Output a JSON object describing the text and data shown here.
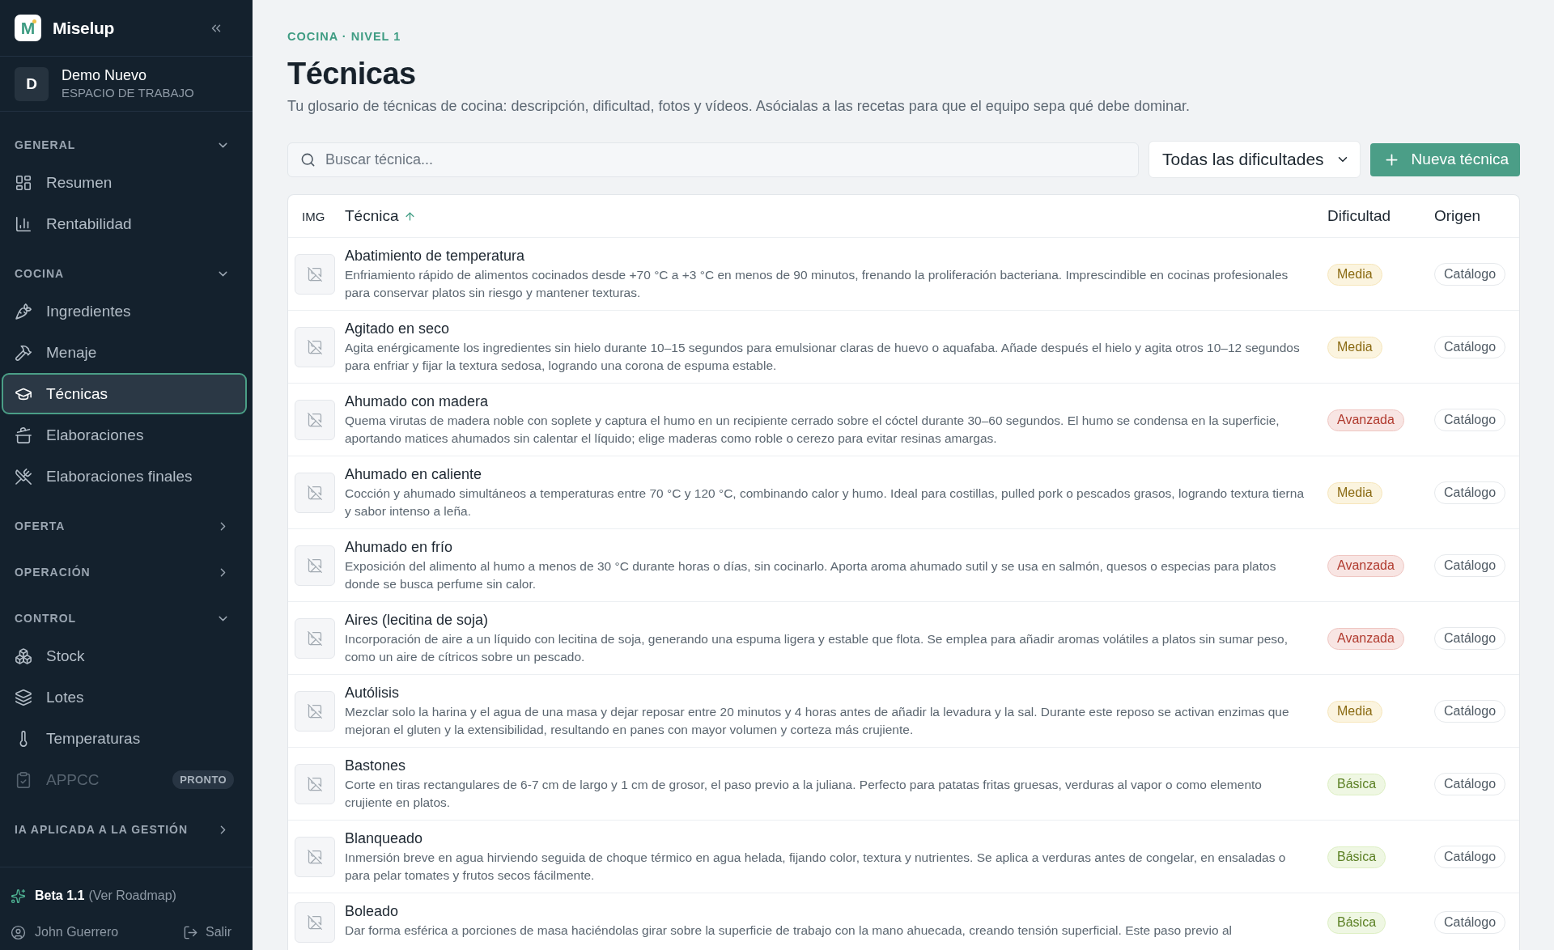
{
  "sidebar": {
    "brand": {
      "logo_letter": "M",
      "name": "Miselup"
    },
    "workspace": {
      "initial": "D",
      "name": "Demo Nuevo",
      "subtitle": "ESPACIO DE TRABAJO"
    },
    "sections": [
      {
        "label": "GENERAL",
        "expanded": true,
        "items": [
          {
            "label": "Resumen",
            "selected": false,
            "disabled": false
          },
          {
            "label": "Rentabilidad",
            "selected": false,
            "disabled": false
          }
        ]
      },
      {
        "label": "COCINA",
        "expanded": true,
        "items": [
          {
            "label": "Ingredientes",
            "selected": false,
            "disabled": false
          },
          {
            "label": "Menaje",
            "selected": false,
            "disabled": false
          },
          {
            "label": "Técnicas",
            "selected": true,
            "disabled": false
          },
          {
            "label": "Elaboraciones",
            "selected": false,
            "disabled": false
          },
          {
            "label": "Elaboraciones finales",
            "selected": false,
            "disabled": false
          }
        ]
      },
      {
        "label": "OFERTA",
        "expanded": false
      },
      {
        "label": "OPERACIÓN",
        "expanded": false
      },
      {
        "label": "CONTROL",
        "expanded": true,
        "items": [
          {
            "label": "Stock",
            "selected": false,
            "disabled": false
          },
          {
            "label": "Lotes",
            "selected": false,
            "disabled": false
          },
          {
            "label": "Temperaturas",
            "selected": false,
            "disabled": false
          },
          {
            "label": "APPCC",
            "selected": false,
            "disabled": true,
            "badge": "PRONTO"
          }
        ]
      },
      {
        "label": "IA APLICADA A LA GESTIÓN",
        "expanded": false
      }
    ],
    "footer": {
      "version": "Beta 1.1",
      "roadmap_link": "(Ver Roadmap)",
      "user": "John Guerrero",
      "logout": "Salir"
    }
  },
  "header": {
    "breadcrumb": "COCINA · NIVEL 1",
    "title": "Técnicas",
    "description": "Tu glosario de técnicas de cocina: descripción, dificultad, fotos y vídeos. Asócialas a las recetas para que el equipo sepa qué debe dominar."
  },
  "toolbar": {
    "search": {
      "placeholder": "Buscar técnica..."
    },
    "filter": {
      "value": "Todas las dificultades"
    },
    "new_button": "Nueva técnica"
  },
  "table": {
    "columns": [
      {
        "label": "IMG",
        "sorted": false
      },
      {
        "label": "Técnica",
        "sorted": true
      },
      {
        "label": "Dificultad",
        "sorted": false
      },
      {
        "label": "Origen",
        "sorted": false
      }
    ],
    "rows": [
      {
        "name": "Abatimiento de temperatura",
        "description": "Enfriamiento rápido de alimentos cocinados desde +70 °C a +3 °C en menos de 90 minutos, frenando la proliferación bacteriana. Imprescindible en cocinas profesionales para conservar platos sin riesgo y mantener texturas.",
        "difficulty": {
          "label": "Media",
          "color": "#8a6a12"
        },
        "origin": "Catálogo"
      },
      {
        "name": "Agitado en seco",
        "description": "Agita enérgicamente los ingredientes sin hielo durante 10–15 segundos para emulsionar claras de huevo o aquafaba. Añade después el hielo y agita otros 10–12 segundos para enfriar y fijar la textura sedosa, logrando una corona de espuma estable.",
        "difficulty": {
          "label": "Media",
          "color": "#8a6a12"
        },
        "origin": "Catálogo"
      },
      {
        "name": "Ahumado con madera",
        "description": "Quema virutas de madera noble con soplete y captura el humo en un recipiente cerrado sobre el cóctel durante 30–60 segundos. El humo se condensa en la superficie, aportando matices ahumados sin calentar el líquido; elige maderas como roble o cerezo para evitar resinas amargas.",
        "difficulty": {
          "label": "Avanzada",
          "color": "#b03a2e"
        },
        "origin": "Catálogo"
      },
      {
        "name": "Ahumado en caliente",
        "description": "Cocción y ahumado simultáneos a temperaturas entre 70 °C y 120 °C, combinando calor y humo. Ideal para costillas, pulled pork o pescados grasos, logrando textura tierna y sabor intenso a leña.",
        "difficulty": {
          "label": "Media",
          "color": "#8a6a12"
        },
        "origin": "Catálogo"
      },
      {
        "name": "Ahumado en frío",
        "description": "Exposición del alimento al humo a menos de 30 °C durante horas o días, sin cocinarlo. Aporta aroma ahumado sutil y se usa en salmón, quesos o especias para platos donde se busca perfume sin calor.",
        "difficulty": {
          "label": "Avanzada",
          "color": "#b03a2e"
        },
        "origin": "Catálogo"
      },
      {
        "name": "Aires (lecitina de soja)",
        "description": "Incorporación de aire a un líquido con lecitina de soja, generando una espuma ligera y estable que flota. Se emplea para añadir aromas volátiles a platos sin sumar peso, como un aire de cítricos sobre un pescado.",
        "difficulty": {
          "label": "Avanzada",
          "color": "#b03a2e"
        },
        "origin": "Catálogo"
      },
      {
        "name": "Autólisis",
        "description": "Mezclar solo la harina y el agua de una masa y dejar reposar entre 20 minutos y 4 horas antes de añadir la levadura y la sal. Durante este reposo se activan enzimas que mejoran el gluten y la extensibilidad, resultando en panes con mayor volumen y corteza más crujiente.",
        "difficulty": {
          "label": "Media",
          "color": "#8a6a12"
        },
        "origin": "Catálogo"
      },
      {
        "name": "Bastones",
        "description": "Corte en tiras rectangulares de 6-7 cm de largo y 1 cm de grosor, el paso previo a la juliana. Perfecto para patatas fritas gruesas, verduras al vapor o como elemento crujiente en platos.",
        "difficulty": {
          "label": "Básica",
          "color": "#5a7f22"
        },
        "origin": "Catálogo"
      },
      {
        "name": "Blanqueado",
        "description": "Inmersión breve en agua hirviendo seguida de choque térmico en agua helada, fijando color, textura y nutrientes. Se aplica a verduras antes de congelar, en ensaladas o para pelar tomates y frutos secos fácilmente.",
        "difficulty": {
          "label": "Básica",
          "color": "#5a7f22"
        },
        "origin": "Catálogo"
      },
      {
        "name": "Boleado",
        "description": "Dar forma esférica a porciones de masa haciéndolas girar sobre la superficie de trabajo con la mano ahuecada, creando tensión superficial. Este paso previo al",
        "difficulty": {
          "label": "Básica",
          "color": "#5a7f22"
        },
        "origin": "Catálogo"
      }
    ]
  }
}
